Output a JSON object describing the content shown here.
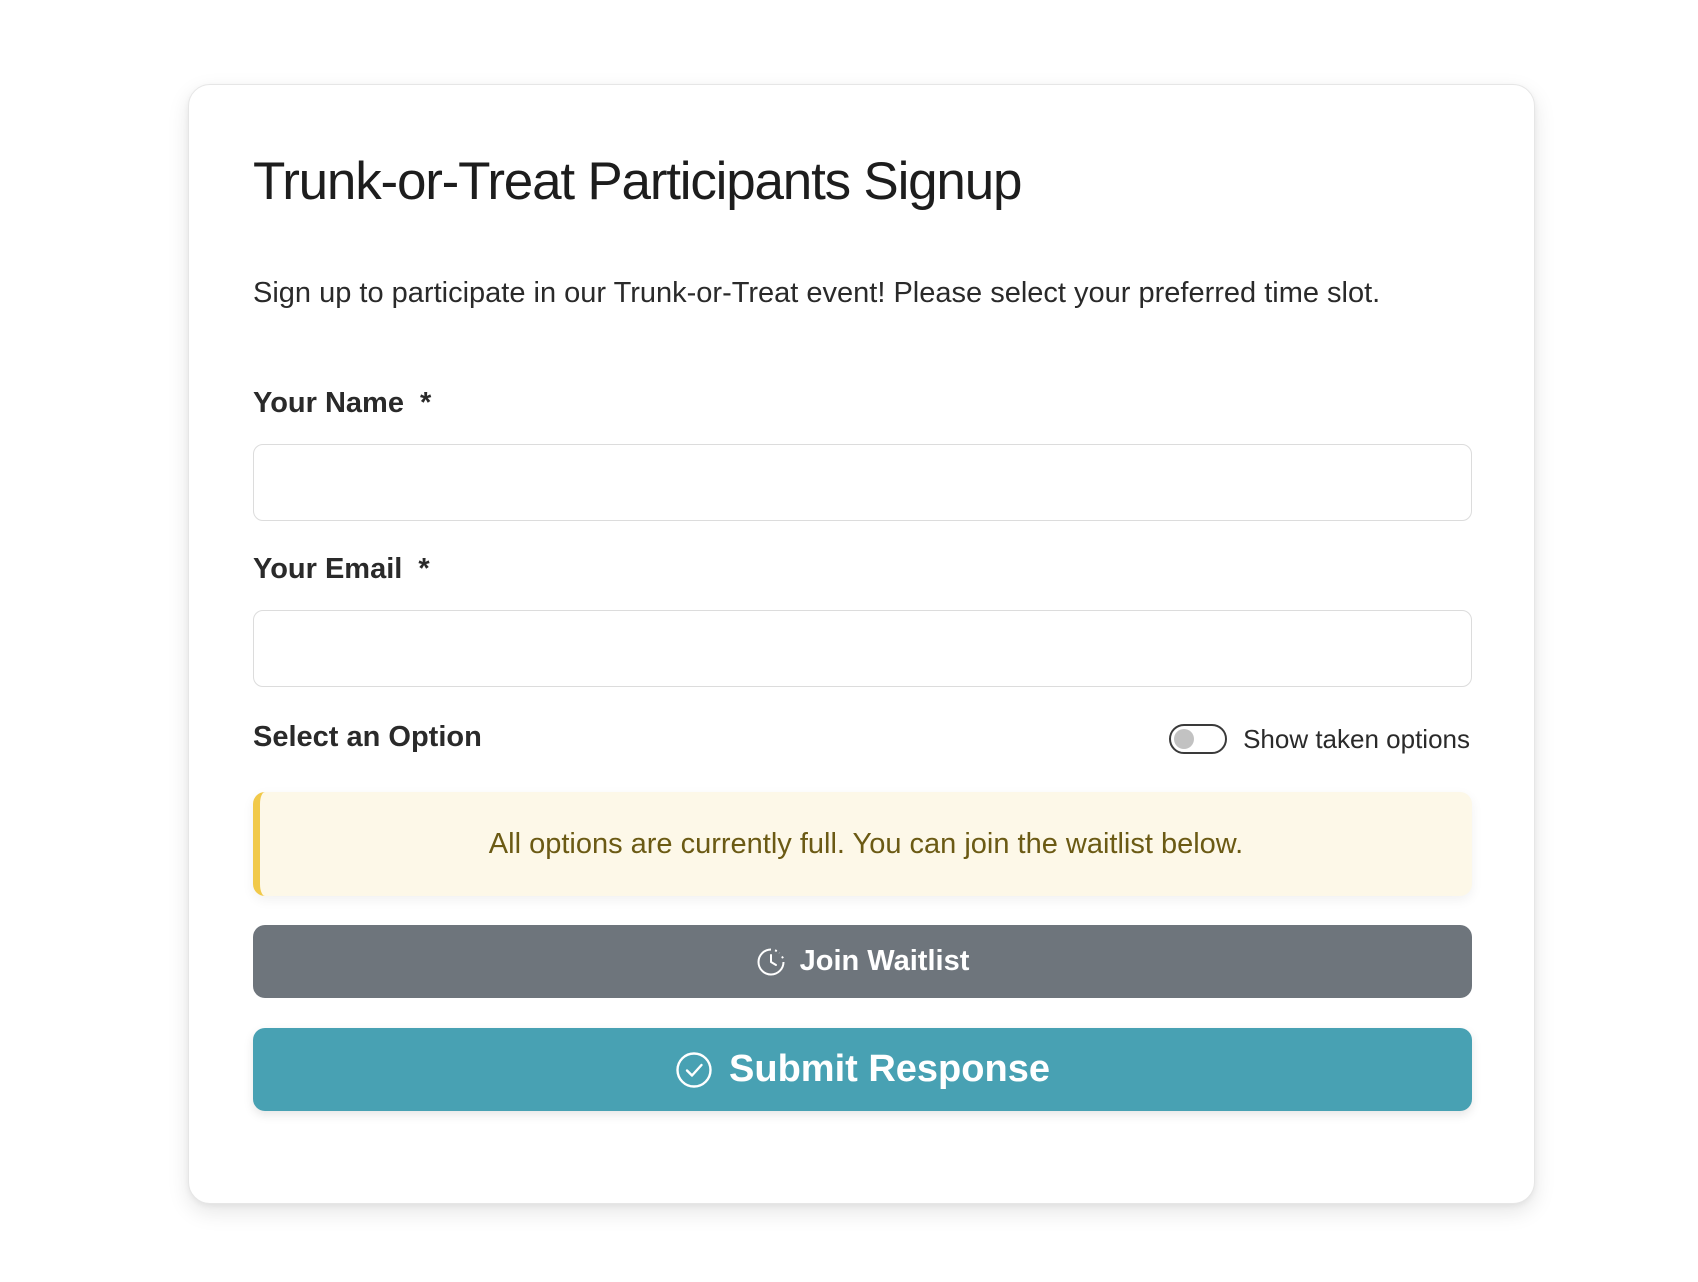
{
  "form": {
    "title": "Trunk-or-Treat Participants Signup",
    "description": "Sign up to participate in our Trunk-or-Treat event! Please select your preferred time slot.",
    "name_field": {
      "label": "Your Name",
      "required_marker": "*",
      "value": "",
      "placeholder": ""
    },
    "email_field": {
      "label": "Your Email",
      "required_marker": "*",
      "value": "",
      "placeholder": ""
    },
    "options_section": {
      "label": "Select an Option",
      "toggle_label": "Show taken options",
      "toggle_on": false
    },
    "alert": {
      "message": "All options are currently full. You can join the waitlist below.",
      "accent_color": "#f1c94a"
    },
    "waitlist_button": {
      "label": "Join Waitlist",
      "icon": "clock-icon",
      "color": "#6e757c"
    },
    "submit_button": {
      "label": "Submit Response",
      "icon": "check-circle-icon",
      "color": "#48a1b3"
    }
  }
}
